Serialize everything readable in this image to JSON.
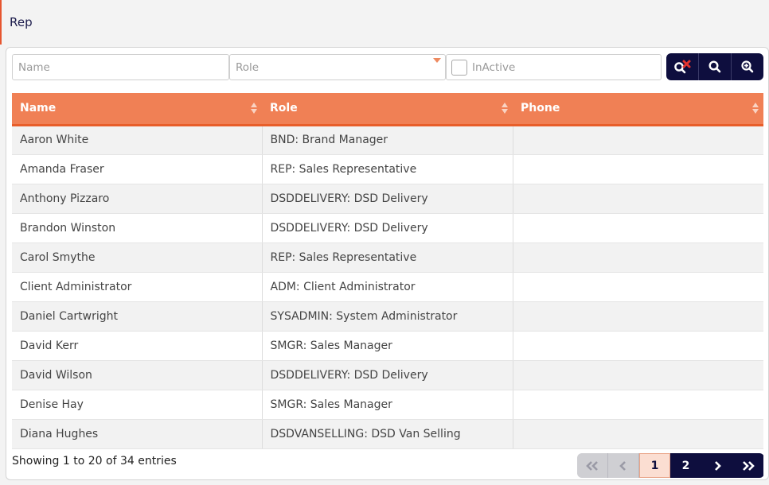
{
  "page": {
    "title": "Rep"
  },
  "colors": {
    "accent": "#f08055",
    "navy": "#0e0e3e",
    "row_alt": "#f2f2f2"
  },
  "filters": {
    "name_placeholder": "Name",
    "role_placeholder": "Role",
    "inactive_label": "InActive",
    "inactive_checked": false
  },
  "toolbar": {
    "buttons": [
      {
        "icon": "clear-search-icon"
      },
      {
        "icon": "search-icon"
      },
      {
        "icon": "zoom-in-icon"
      }
    ]
  },
  "table": {
    "headers": [
      "Name",
      "Role",
      "Phone"
    ],
    "rows": [
      {
        "name": "Aaron White",
        "role": "BND: Brand Manager",
        "phone": ""
      },
      {
        "name": "Amanda Fraser",
        "role": "REP: Sales Representative",
        "phone": ""
      },
      {
        "name": "Anthony Pizzaro",
        "role": "DSDDELIVERY: DSD Delivery",
        "phone": ""
      },
      {
        "name": "Brandon Winston",
        "role": "DSDDELIVERY: DSD Delivery",
        "phone": ""
      },
      {
        "name": "Carol Smythe",
        "role": "REP: Sales Representative",
        "phone": ""
      },
      {
        "name": "Client Administrator",
        "role": "ADM: Client Administrator",
        "phone": ""
      },
      {
        "name": "Daniel Cartwright",
        "role": "SYSADMIN: System Administrator",
        "phone": ""
      },
      {
        "name": "David Kerr",
        "role": "SMGR: Sales Manager",
        "phone": ""
      },
      {
        "name": "David Wilson",
        "role": "DSDDELIVERY: DSD Delivery",
        "phone": ""
      },
      {
        "name": "Denise Hay",
        "role": "SMGR: Sales Manager",
        "phone": ""
      },
      {
        "name": "Diana Hughes",
        "role": "DSDVANSELLING: DSD Van Selling",
        "phone": ""
      }
    ]
  },
  "footer": {
    "info": "Showing 1 to 20 of 34 entries"
  },
  "pagination": {
    "first_label": "«",
    "prev_label": "‹",
    "pages": [
      "1",
      "2"
    ],
    "current_page": "1",
    "next_label": "›",
    "last_label": "»"
  }
}
